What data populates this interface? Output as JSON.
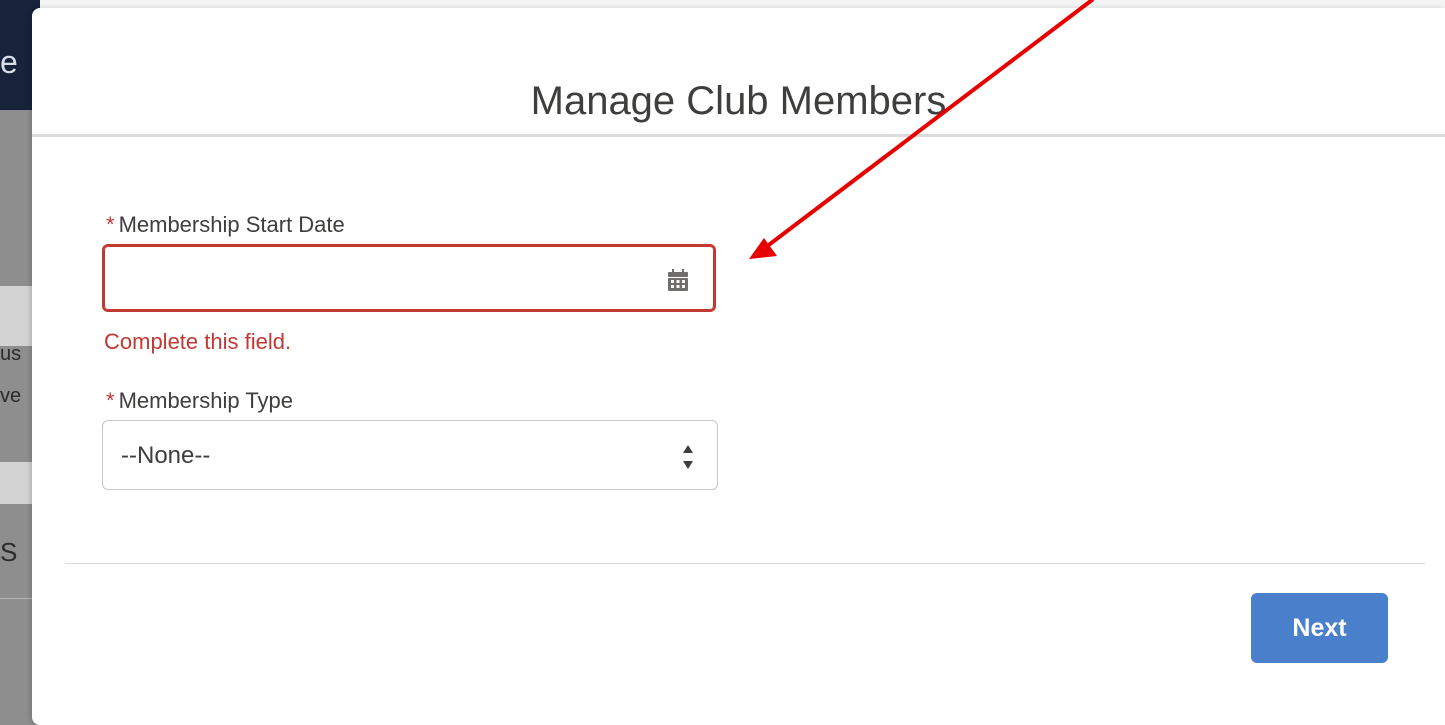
{
  "background": {
    "header_fragment": "e",
    "text_fragments": [
      "us",
      "ve",
      "S"
    ]
  },
  "modal": {
    "title": "Manage Club Members",
    "fields": {
      "start_date": {
        "required_marker": "*",
        "label": "Membership Start Date",
        "value": "",
        "error": "Complete this field.",
        "icon": "calendar-icon"
      },
      "membership_type": {
        "required_marker": "*",
        "label": "Membership Type",
        "selected": "--None--",
        "icon": "up-down-arrows-icon"
      }
    },
    "footer": {
      "next_label": "Next"
    }
  },
  "colors": {
    "error": "#c23934",
    "primary_button": "#4a7fcc",
    "annotation_arrow": "#e60000"
  }
}
